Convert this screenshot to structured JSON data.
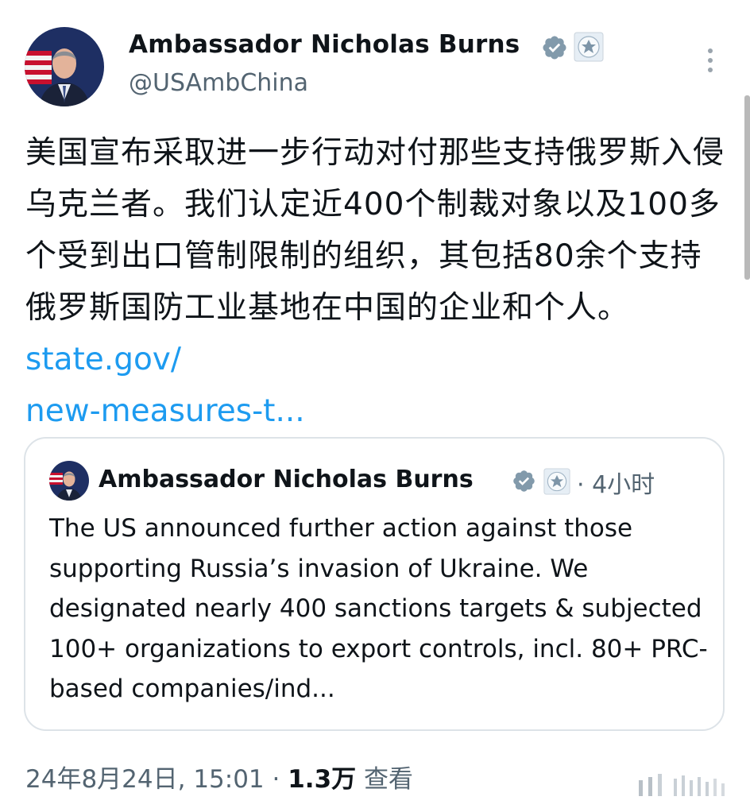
{
  "tweet": {
    "display_name": "Ambassador Nicholas Burns",
    "handle": "@USAmbChina",
    "text_zh": "美国宣布采取进一步行动对付那些支持俄罗斯入侵乌克兰者。我们认定近400个制裁对象以及100多个受到出口管制限制的组织，其包括80余个支持俄罗斯国防工业基地在中国的企业和个人。",
    "link_part1": "state.gov/",
    "link_part2": "new-measures-t...",
    "quote": {
      "display_name": "Ambassador Nicholas Burns",
      "time": "· 4小时",
      "text": "The US announced further action against those supporting Russia’s invasion of Ukraine. We designated nearly 400 sanctions targets & subjected 100+ organizations to export controls, incl. 80+ PRC-based companies/ind..."
    },
    "meta": {
      "date": "24年8月24日, 15:01 · ",
      "views": "1.3万",
      "views_label": " 查看"
    }
  },
  "icons": {
    "verified": "verified-badge-icon",
    "seal": "embassy-seal-icon",
    "more": "more-vertical-icon",
    "stats": "stats-icon"
  },
  "colors": {
    "link": "#1d9bf0",
    "secondary_text": "#536471",
    "badge": "#829aab"
  }
}
